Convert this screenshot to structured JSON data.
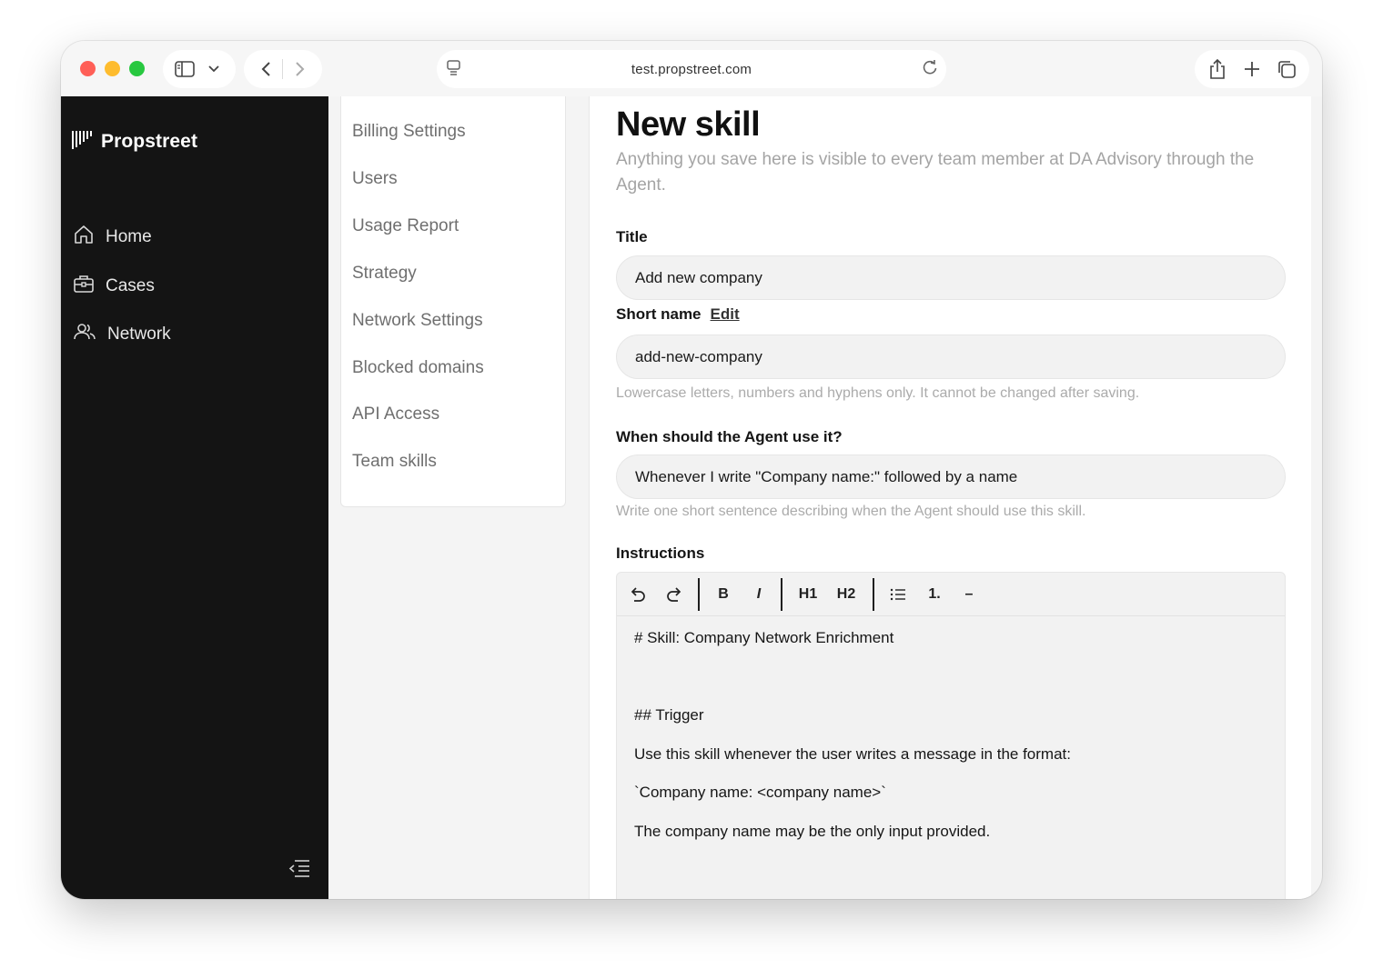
{
  "browser": {
    "url": "test.propstreet.com"
  },
  "app": {
    "brand": "Propstreet",
    "nav": [
      {
        "label": "Home",
        "icon": "home-icon"
      },
      {
        "label": "Cases",
        "icon": "briefcase-icon"
      },
      {
        "label": "Network",
        "icon": "users-icon"
      }
    ]
  },
  "settings_menu": {
    "items": [
      "Billing Settings",
      "Users",
      "Usage Report",
      "Strategy",
      "Network Settings",
      "Blocked domains",
      "API Access",
      "Team skills"
    ]
  },
  "form": {
    "page_title": "New skill",
    "subtitle": "Anything you save here is visible to every team member at DA Advisory through the Agent.",
    "title_label": "Title",
    "title_value": "Add new company",
    "short_name_label": "Short name",
    "short_name_edit": "Edit",
    "short_name_value": "add-new-company",
    "short_name_hint": "Lowercase letters, numbers and hyphens only. It cannot be changed after saving.",
    "when_label": "When should the Agent use it?",
    "when_value": "Whenever I write \"Company name:\" followed by a name",
    "when_hint": "Write one short sentence describing when the Agent should use this skill.",
    "instructions_label": "Instructions"
  },
  "editor": {
    "toolbar": {
      "bold": "B",
      "italic": "I",
      "h1": "H1",
      "h2": "H2",
      "ordered_list": "1.",
      "horizontal_rule": "–"
    },
    "lines": [
      "# Skill: Company Network Enrichment",
      "## Trigger",
      "Use this skill whenever the user writes a message in the format:",
      "`Company name: <company name>`",
      "The company name may be the only input provided."
    ]
  }
}
